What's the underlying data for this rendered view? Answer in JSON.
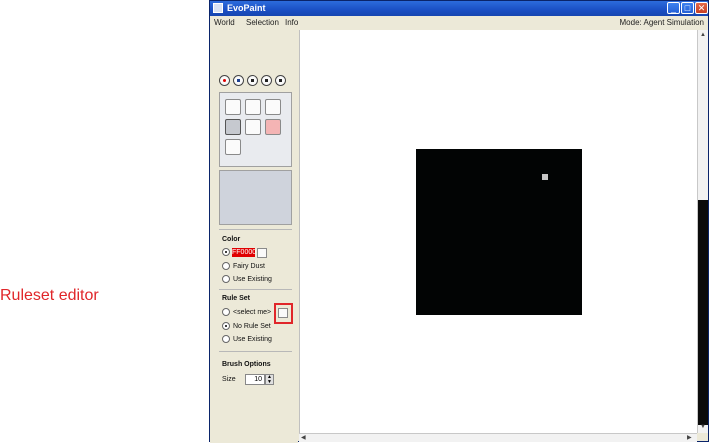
{
  "annotation": {
    "label": "Ruleset editor",
    "color": "#e0262a"
  },
  "window": {
    "title": "EvoPaint",
    "controls": [
      "minimize-icon",
      "maximize-icon",
      "close-icon"
    ]
  },
  "menubar": {
    "items": [
      "World",
      "Selection",
      "Info"
    ],
    "mode_label": "Mode: Agent Simulation"
  },
  "playback": {
    "buttons": [
      "record-icon",
      "play-icon",
      "pause-icon",
      "stop-icon",
      "eject-icon"
    ]
  },
  "tools": [
    "select-rectangle-icon",
    "move-icon",
    "zoom-icon",
    "paint-brush-icon",
    "hand-icon",
    "eraser-icon",
    "eyedropper-icon"
  ],
  "color_section": {
    "title": "Color",
    "swatch_value": "#FF0000",
    "swatch_display": "FF0000",
    "options": [
      "Fairy Dust",
      "Use Existing"
    ],
    "selected": "swatch"
  },
  "ruleset_section": {
    "title": "Rule Set",
    "options": [
      "<select me>",
      "No Rule Set",
      "Use Existing"
    ],
    "selected": "No Rule Set"
  },
  "brush_options": {
    "title": "Brush Options",
    "size_label": "Size",
    "size_value": "10"
  },
  "world": {
    "background": "#020404",
    "agent_color": "#c6c6c6"
  }
}
